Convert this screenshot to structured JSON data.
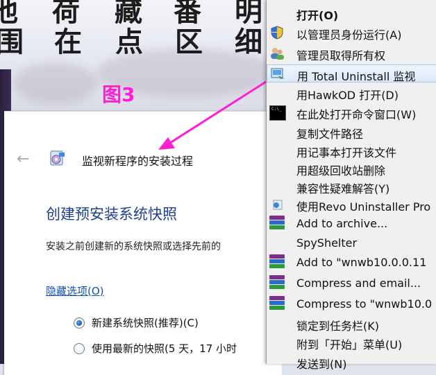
{
  "background": {
    "calligraphy_top": [
      "池",
      "荷",
      "藏",
      "番",
      "明"
    ],
    "calligraphy_bottom": [
      "围",
      "在",
      "点",
      "区",
      "细"
    ]
  },
  "annotation": {
    "label": "图3",
    "color": "#ff1fd2"
  },
  "dialog": {
    "back_icon": "back-arrow-icon",
    "title": "监视新程序的安装过程",
    "heading": "创建预安装系统快照",
    "description": "安装之前创建新的系统快照或选择先前的",
    "options_link": "隐藏选项(O)",
    "options": [
      {
        "label": "新建系统快照(推荐)(C)",
        "selected": true
      },
      {
        "label": "使用最新的快照(5 天，17 小时",
        "selected": false
      }
    ]
  },
  "context_menu": {
    "items": [
      {
        "label": "打开(O)",
        "icon": "",
        "bold": true
      },
      {
        "label": "以管理员身份运行(A)",
        "icon": "uac-shield-icon"
      },
      {
        "label": "管理员取得所有权",
        "icon": "users-icon"
      },
      {
        "label": "用 Total Uninstall 监视",
        "icon": "total-uninstall-icon",
        "highlighted": true
      },
      {
        "label": "用HawkOD 打开(D)",
        "icon": ""
      },
      {
        "label": "在此处打开命令窗口(W)",
        "icon": "cmd-icon"
      },
      {
        "label": "复制文件路径",
        "icon": ""
      },
      {
        "label": "用记事本打开该文件",
        "icon": ""
      },
      {
        "label": "用超级回收站删除",
        "icon": ""
      },
      {
        "label": "兼容性疑难解答(Y)",
        "icon": ""
      },
      {
        "label": "使用Revo Uninstaller Pro",
        "icon": "revo-uninstaller-icon"
      },
      {
        "label": "Add to archive...",
        "icon": "winrar-icon"
      },
      {
        "label": "SpyShelter",
        "icon": ""
      },
      {
        "label": "Add to \"wnwb10.0.0.11",
        "icon": "winrar-icon"
      },
      {
        "label": "Compress and email...",
        "icon": "winrar-icon"
      },
      {
        "label": "Compress to \"wnwb10.0",
        "icon": "winrar-icon"
      },
      {
        "label": "锁定到任务栏(K)",
        "icon": ""
      },
      {
        "label": "附到「开始」菜单(U)",
        "icon": ""
      },
      {
        "label": "发送到(N)",
        "icon": ""
      }
    ]
  }
}
